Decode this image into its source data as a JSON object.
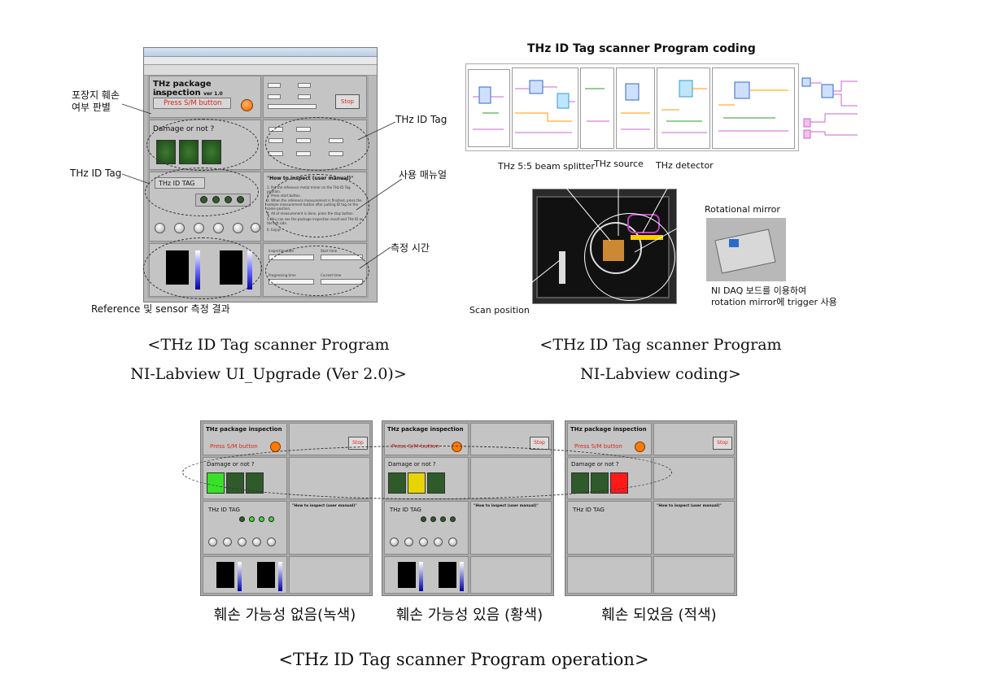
{
  "ui": {
    "title": "THz package inspection",
    "version_main": "ver 1.0",
    "status_label": "Status",
    "press_button": "Press S/M button",
    "stop_button": "Stop",
    "damage_title": "Damage or not ?",
    "tag_title": "THz ID TAG",
    "howto_title": "\"How to inspect (user manual)\"",
    "howto_lines": [
      "1. Put the reference metal mirror on the THz ID Tag position.",
      "2. Press start button.",
      "3. When the reference measurement is finished, press the sample measurement button after putting ID tag on the same position.",
      "4. All of measurement is done, press the stop button.",
      "5. You can see the package inspection result and THz ID on the left side.",
      "6. Enjoy!"
    ],
    "inspection_date": "Inspection date",
    "start_time": "Start time",
    "progress_time": "Progressing time",
    "current_time": "Current time",
    "reference": "Reference",
    "sample": "Sample"
  },
  "annotations": {
    "damage_check": "포장지 훼손\n여부 판별",
    "thz_id_tag_left": "THz ID Tag",
    "thz_id_tag_right": "THz ID Tag",
    "user_manual": "사용 매뉴얼",
    "measure_time": "측정 시간",
    "result": "Reference 및 sensor 측정 결과"
  },
  "coding": {
    "title": "THz ID Tag scanner Program coding"
  },
  "photo": {
    "beam_splitter": "THz 5:5 beam splitter",
    "source": "THz source",
    "detector": "THz detector",
    "rotational_mirror": "Rotational mirror",
    "scan_position": "Scan position",
    "daq_note_1": "NI DAQ 보드를 이용하여",
    "daq_note_2": "rotation mirror에 trigger 사용"
  },
  "captions": {
    "left_line1": "<THz ID Tag scanner Program",
    "left_line2": "NI-Labview UI_Upgrade (Ver 2.0)>",
    "right_line1": "<THz ID Tag scanner Program",
    "right_line2": "NI-Labview coding>",
    "green": "훼손 가능성 없음(녹색)",
    "yellow": "훼손 가능성 있음 (황색)",
    "red": "훼손 되었음 (적색)",
    "bottom": "<THz ID Tag scanner Program operation>"
  },
  "colors": {
    "led_off": "#2f6b2a",
    "led_green": "#38e02a",
    "led_yellow": "#e8d400",
    "led_red": "#ff1a1a",
    "press_text": "#e0241a",
    "stop_orange": "#ff7a00"
  }
}
